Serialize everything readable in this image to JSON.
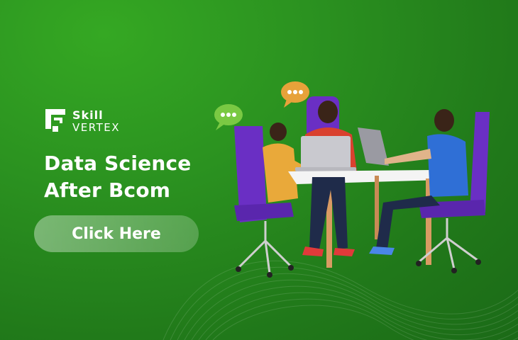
{
  "brand": {
    "name_line1": "Skill",
    "name_line2": "VERTEX"
  },
  "headline": {
    "line1": "Data Science",
    "line2": "After Bcom"
  },
  "cta": {
    "label": "Click Here"
  },
  "colors": {
    "background": "#2a8a1e",
    "chair": "#6a2fc4",
    "speech_bubble_green": "#7ac943",
    "speech_bubble_orange": "#e7a23a"
  },
  "illustration": {
    "subject": "three-people-at-meeting-table",
    "icons": [
      "speech-bubble-icon",
      "speech-bubble-icon"
    ]
  }
}
